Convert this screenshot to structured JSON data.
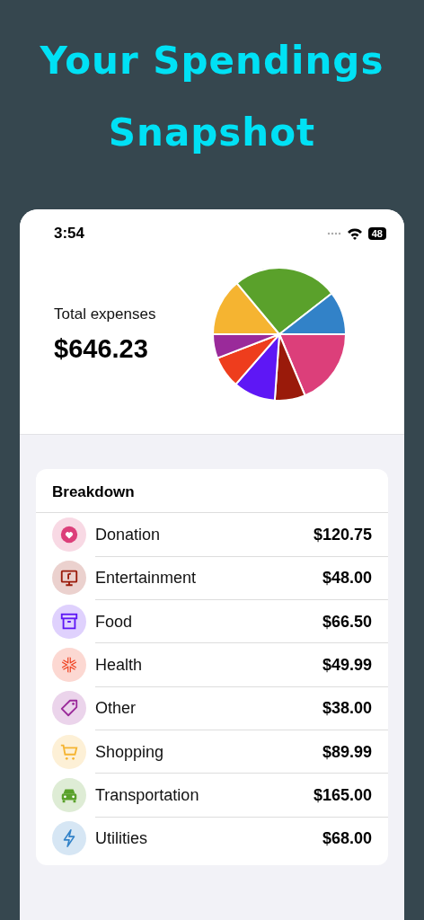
{
  "headline": [
    "Your Spendings",
    "Snapshot"
  ],
  "status_bar": {
    "time": "3:54",
    "battery": "48"
  },
  "summary": {
    "label": "Total expenses",
    "total": "$646.23"
  },
  "breakdown": {
    "title": "Breakdown",
    "items": [
      {
        "kind": "heart",
        "name": "Donation",
        "amount": "$120.75",
        "color": "#dc3f7a"
      },
      {
        "kind": "tv",
        "name": "Entertainment",
        "amount": "$48.00",
        "color": "#9a1a0a"
      },
      {
        "kind": "box",
        "name": "Food",
        "amount": "$66.50",
        "color": "#5e17f5"
      },
      {
        "kind": "asterisk",
        "name": "Health",
        "amount": "$49.99",
        "color": "#ee3d1d"
      },
      {
        "kind": "tag",
        "name": "Other",
        "amount": "$38.00",
        "color": "#9a2a9a"
      },
      {
        "kind": "cart",
        "name": "Shopping",
        "amount": "$89.99",
        "color": "#f5b431"
      },
      {
        "kind": "car",
        "name": "Transportation",
        "amount": "$165.00",
        "color": "#5aa12b"
      },
      {
        "kind": "bolt",
        "name": "Utilities",
        "amount": "$68.00",
        "color": "#3282c8"
      }
    ]
  }
}
